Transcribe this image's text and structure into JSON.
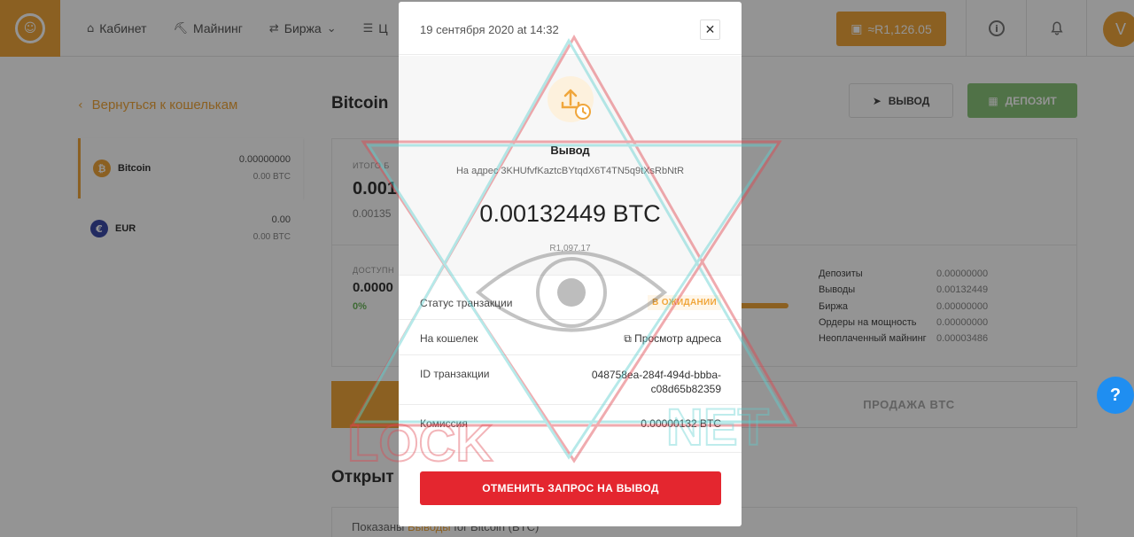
{
  "topbar": {
    "nav": [
      {
        "label": "Кабинет",
        "icon": "home-icon",
        "glyph": "⌂"
      },
      {
        "label": "Майнинг",
        "icon": "pickaxe-icon",
        "glyph": "⛏"
      },
      {
        "label": "Биржа",
        "icon": "exchange-icon",
        "glyph": "⇄"
      },
      {
        "label": "Ц",
        "icon": "stack-icon",
        "glyph": "☰"
      }
    ],
    "exchange_chevron": "⌄",
    "balance": "≈R1,126.05",
    "avatar_letter": "V"
  },
  "sidebar": {
    "back_label": "Вернуться к кошелькам",
    "wallets": [
      {
        "name": "Bitcoin",
        "symbol": "₿",
        "color": "#f0a63b",
        "value": "0.00000000",
        "fiat": "0.00 BTC"
      },
      {
        "name": "EUR",
        "symbol": "€",
        "color": "#3b4aa8",
        "value": "0.00",
        "fiat": "0.00 BTC"
      }
    ]
  },
  "main": {
    "title": "Bitcoin",
    "withdraw_label": "ВЫВОД",
    "deposit_label": "ДЕПОЗИТ",
    "total_label": "ИТОГО Б",
    "total_value": "0.001",
    "total_sub": "0.00135",
    "available_label": "ДОСТУПН",
    "available_value": "0.0000",
    "available_pct": "0%",
    "stats": [
      {
        "label": "Депозиты",
        "value": "0.00000000"
      },
      {
        "label": "Выводы",
        "value": "0.00132449"
      },
      {
        "label": "Биржа",
        "value": "0.00000000"
      },
      {
        "label": "Ордеры на мощность",
        "value": "0.00000000"
      },
      {
        "label": "Неоплаченный майнинг",
        "value": "0.00003486"
      }
    ],
    "sell_label": "ПРОДАЖА BTC",
    "open_title": "Открыт",
    "shown_prefix": "Показаны ",
    "shown_highlight": "Выводы",
    "shown_suffix": " for Bitcoin (BTC)"
  },
  "modal": {
    "date": "19 сентября 2020 at 14:32",
    "type": "Вывод",
    "address": "На адрес 3KHUfvfKaztcBYtqdX6T4TN5q9tXsRbNtR",
    "amount": "0.00132449 BTC",
    "fiat": "R1,097.17",
    "status_label": "Статус транзакции",
    "status_value": "В ОЖИДАНИИ",
    "wallet_label": "На кошелек",
    "wallet_link": "Просмотр адреса",
    "txid_label": "ID транзакции",
    "txid_line1": "048758ea-284f-494d-bbba-",
    "txid_line2": "c08d65b82359",
    "fee_label": "Комиссия",
    "fee_value": "0.00000132 BTC",
    "cancel_label": "ОТМЕНИТЬ ЗАПРОС НА ВЫВОД"
  },
  "watermark_text": {
    "left": "LOCK",
    "right": "NET"
  },
  "help_label": "?",
  "colors": {
    "accent": "#f0a63b",
    "danger": "#e4262f",
    "deposit": "#8ac47a",
    "link": "#1f8ef1"
  }
}
